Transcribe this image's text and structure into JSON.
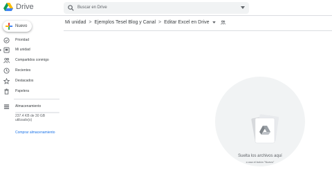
{
  "app": {
    "name": "Drive"
  },
  "search": {
    "placeholder": "Buscar en Drive"
  },
  "new_button": {
    "label": "Nuevo"
  },
  "sidebar": {
    "items": [
      {
        "label": "Prioridad",
        "icon": "check-circle-icon"
      },
      {
        "label": "Mi unidad",
        "icon": "my-drive-icon"
      },
      {
        "label": "Compartidos conmigo",
        "icon": "shared-people-icon"
      },
      {
        "label": "Recientes",
        "icon": "clock-icon"
      },
      {
        "label": "Destacados",
        "icon": "star-icon"
      },
      {
        "label": "Papelera",
        "icon": "trash-icon"
      }
    ],
    "storage": {
      "label": "Almacenamiento",
      "usage": "237.4 KB de 30 GB utilizado(s)",
      "buy_link": "Comprar almacenamiento"
    }
  },
  "breadcrumb": {
    "items": [
      "Mi unidad",
      "Ejemplos Tesel Blog y Canal",
      "Editar Excel en Drive"
    ]
  },
  "empty_state": {
    "title": "Suelta los archivos aquí",
    "subtitle": "o usa el botón \"Nuevo\""
  },
  "colors": {
    "accent": "#1a73e8",
    "surface": "#f1f3f4"
  }
}
